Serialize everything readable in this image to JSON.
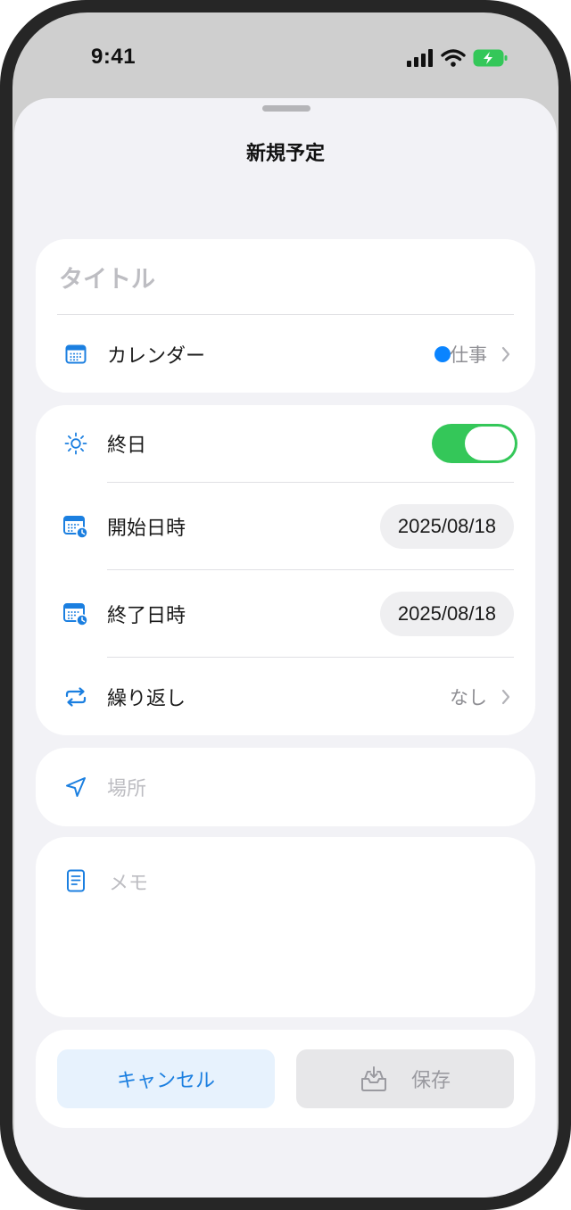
{
  "status_bar": {
    "time": "9:41"
  },
  "sheet": {
    "title": "新規予定"
  },
  "title_field": {
    "placeholder": "タイトル"
  },
  "calendar": {
    "label": "カレンダー",
    "value": "仕事",
    "dot_color": "#0a84ff"
  },
  "all_day": {
    "label": "終日",
    "enabled": true
  },
  "start": {
    "label": "開始日時",
    "value": "2025/08/18"
  },
  "end": {
    "label": "終了日時",
    "value": "2025/08/18"
  },
  "repeat": {
    "label": "繰り返し",
    "value": "なし"
  },
  "location": {
    "placeholder": "場所"
  },
  "memo": {
    "placeholder": "メモ"
  },
  "actions": {
    "cancel_label": "キャンセル",
    "save_label": "保存"
  },
  "colors": {
    "accent": "#1b7fe0",
    "toggle_on": "#34c759",
    "sheet_bg": "#f2f2f6"
  }
}
